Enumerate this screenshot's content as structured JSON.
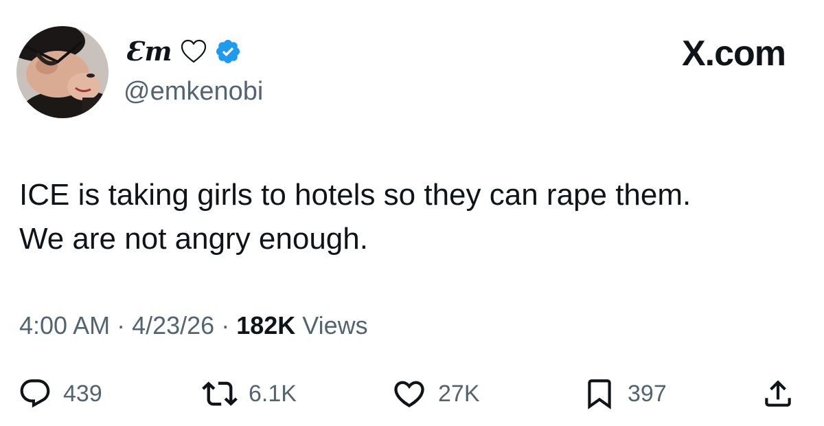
{
  "author": {
    "display_name": "Ɛm",
    "handle": "@emkenobi",
    "name_icon": "heart-outline-icon",
    "verified_icon": "verified-badge-icon"
  },
  "brand": {
    "label": "X.com"
  },
  "tweet": {
    "lines": [
      "ICE is taking girls to hotels so they can rape them.",
      "We are not angry enough."
    ]
  },
  "meta": {
    "time": "4:00 AM",
    "date": "4/23/26",
    "separator": "·",
    "views_count": "182K",
    "views_label": "Views"
  },
  "actions": {
    "reply": {
      "icon": "reply-icon",
      "count": "439"
    },
    "repost": {
      "icon": "repost-icon",
      "count": "6.1K"
    },
    "like": {
      "icon": "heart-icon",
      "count": "27K"
    },
    "bookmark": {
      "icon": "bookmark-icon",
      "count": "397"
    },
    "share": {
      "icon": "share-icon"
    }
  },
  "colors": {
    "text_primary": "#0f1419",
    "text_secondary": "#536471",
    "verified_blue": "#1d9bf0",
    "background": "#ffffff"
  }
}
